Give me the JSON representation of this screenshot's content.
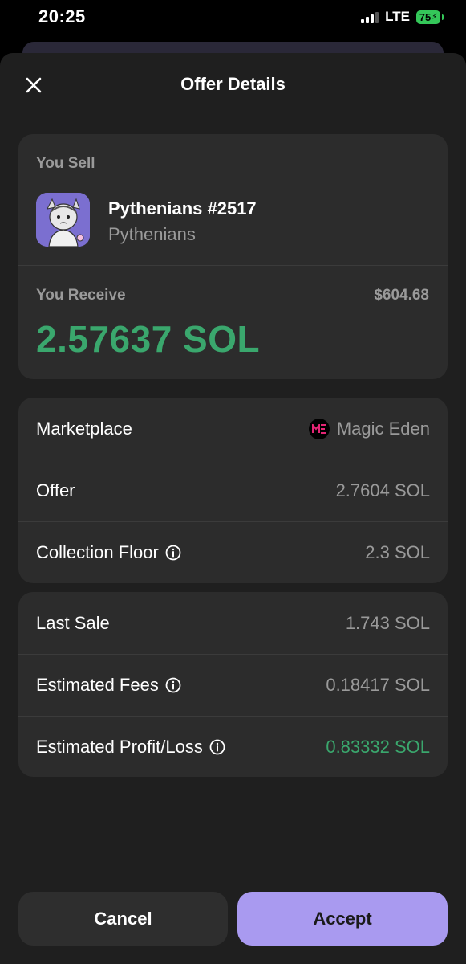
{
  "status_bar": {
    "time": "20:25",
    "network": "LTE",
    "battery": "75"
  },
  "header": {
    "title": "Offer Details",
    "close_icon": "close-icon"
  },
  "sell": {
    "label": "You Sell",
    "nft_name": "Pythenians #2517",
    "collection": "Pythenians"
  },
  "receive": {
    "label": "You Receive",
    "usd": "$604.68",
    "amount": "2.57637 SOL"
  },
  "details": [
    {
      "label": "Marketplace",
      "value": "Magic Eden",
      "info": false
    },
    {
      "label": "Offer",
      "value": "2.7604 SOL",
      "info": false
    },
    {
      "label": "Collection Floor",
      "value": "2.3 SOL",
      "info": true
    }
  ],
  "stats": [
    {
      "label": "Last Sale",
      "value": "1.743 SOL",
      "info": false
    },
    {
      "label": "Estimated Fees",
      "value": "0.18417 SOL",
      "info": true
    },
    {
      "label": "Estimated Profit/Loss",
      "value": "0.83332 SOL",
      "info": true
    }
  ],
  "actions": {
    "cancel": "Cancel",
    "accept": "Accept"
  },
  "colors": {
    "accent": "#a99af0",
    "positive": "#3aa76d",
    "sheet": "#1f1f1f",
    "card": "#2c2c2c"
  }
}
